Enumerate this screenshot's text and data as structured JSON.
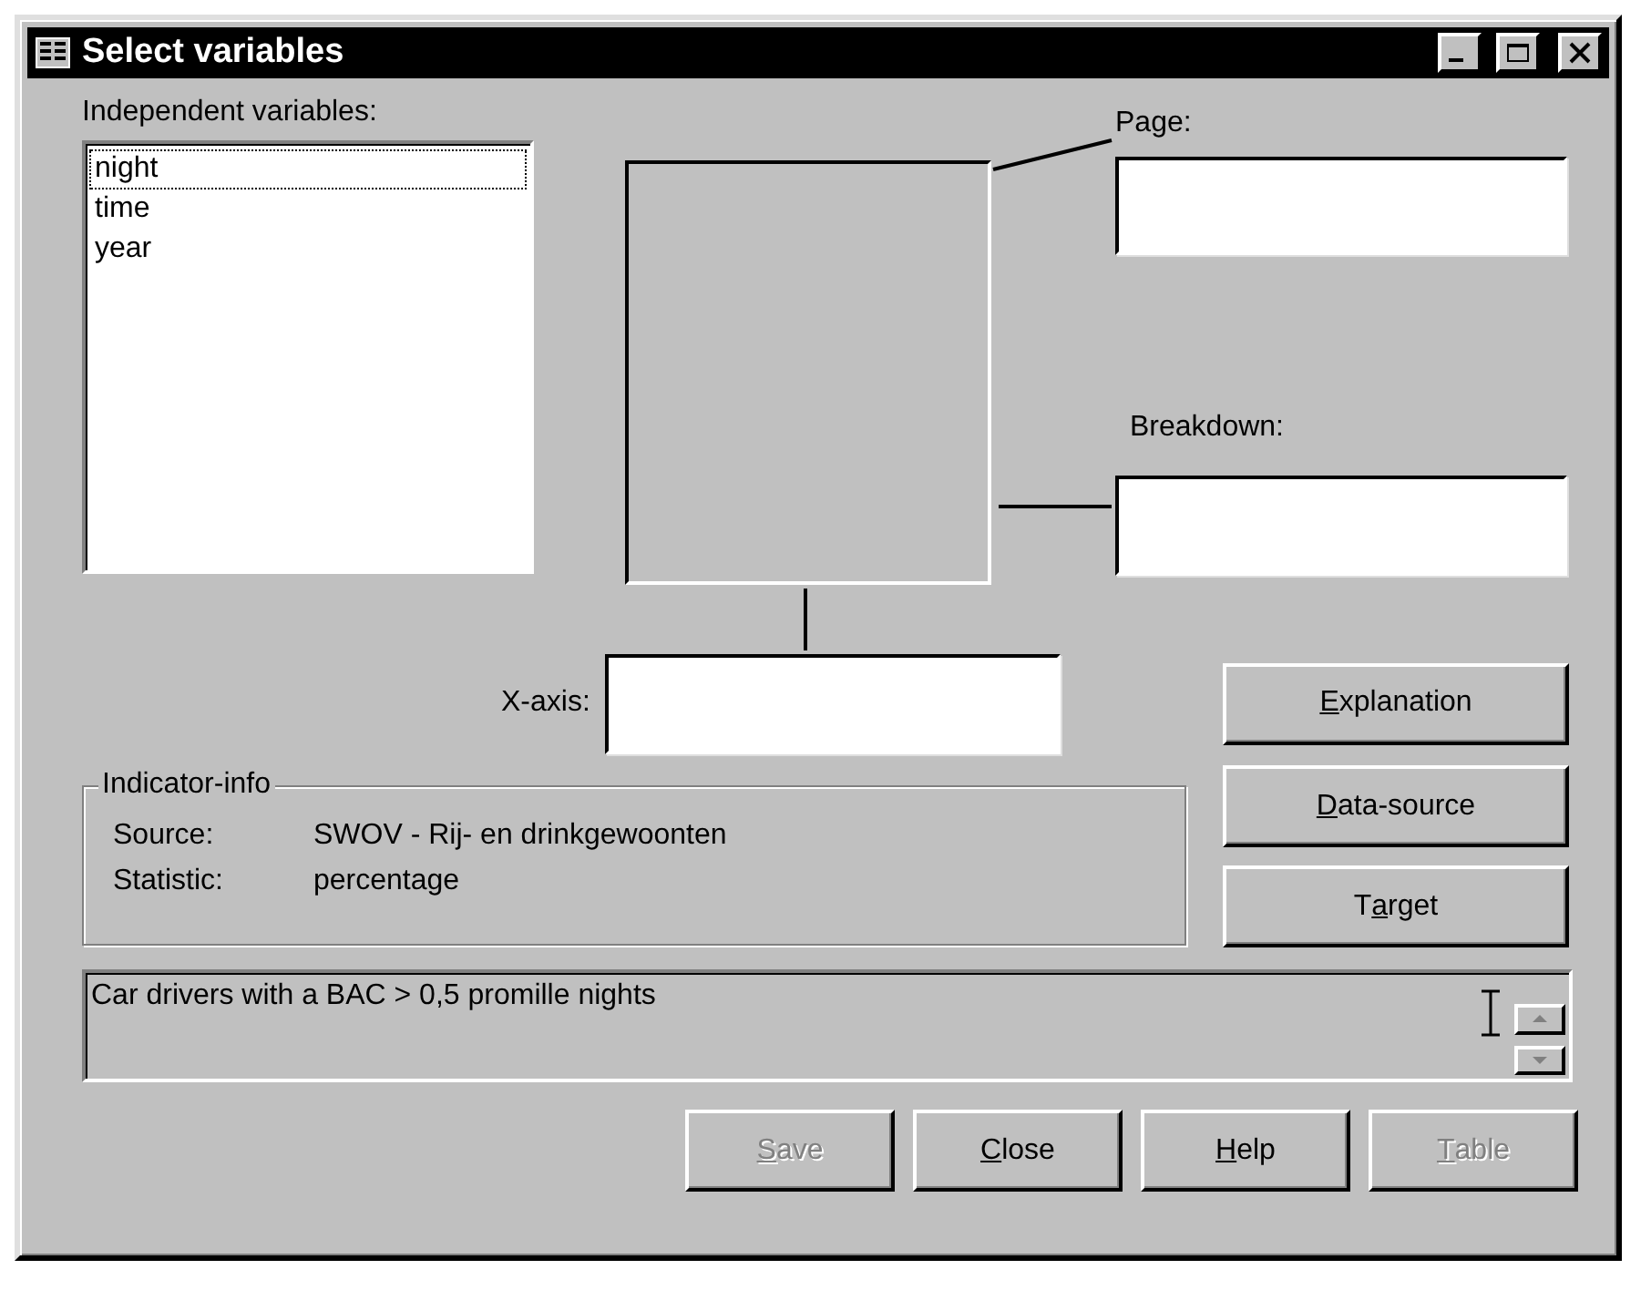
{
  "window": {
    "title": "Select variables"
  },
  "independent_variables": {
    "label": "Independent variables:",
    "items": [
      {
        "text": "night",
        "focused": true
      },
      {
        "text": "time",
        "focused": false
      },
      {
        "text": "year",
        "focused": false
      }
    ]
  },
  "page": {
    "label": "Page:"
  },
  "breakdown": {
    "label": "Breakdown:"
  },
  "x_axis": {
    "label": "X-axis:"
  },
  "side_buttons": [
    {
      "key": "E",
      "post": "xplanation",
      "disabled": false
    },
    {
      "key": "D",
      "post": "ata-source",
      "disabled": false
    },
    {
      "pre": "T",
      "key": "a",
      "post": "rget",
      "disabled": false
    }
  ],
  "indicator_info": {
    "title": "Indicator-info",
    "rows": [
      {
        "label": "Source:",
        "value": "SWOV - Rij- en drinkgewoonten"
      },
      {
        "label": "Statistic:",
        "value": "percentage"
      }
    ]
  },
  "description": {
    "value": "Car drivers with a BAC > 0,5 promille nights"
  },
  "buttons": [
    {
      "key": "S",
      "post": "ave",
      "disabled": true
    },
    {
      "key": "C",
      "post": "lose",
      "disabled": false
    },
    {
      "key": "H",
      "post": "elp",
      "disabled": false
    },
    {
      "key": "T",
      "post": "able",
      "disabled": true
    }
  ]
}
